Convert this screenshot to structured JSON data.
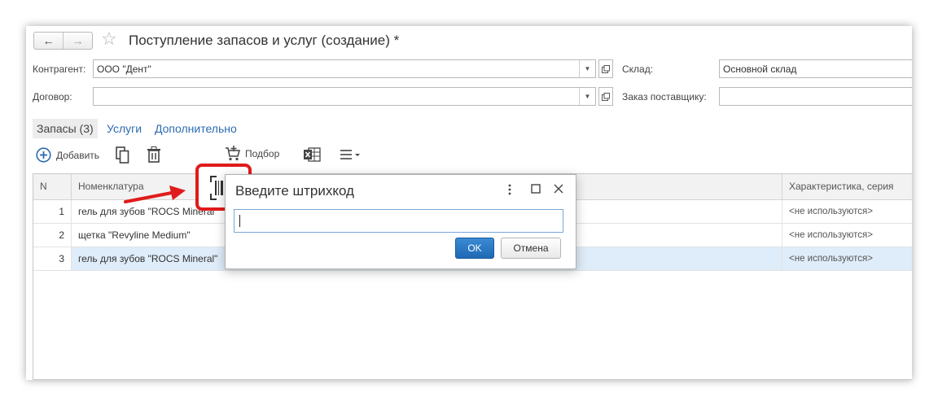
{
  "window": {
    "title": "Поступление запасов и услуг (создание) *",
    "nav": {
      "back": "←",
      "forward": "→"
    }
  },
  "form": {
    "counterparty": {
      "label": "Контрагент:",
      "value": "ООО \"Дент\""
    },
    "contract": {
      "label": "Договор:",
      "value": ""
    },
    "warehouse": {
      "label": "Склад:",
      "value": "Основной склад"
    },
    "supplier_order": {
      "label": "Заказ поставщику:",
      "value": ""
    }
  },
  "tabs": [
    {
      "label": "Запасы (3)",
      "active": true
    },
    {
      "label": "Услуги",
      "active": false
    },
    {
      "label": "Дополнительно",
      "active": false
    }
  ],
  "toolbar": {
    "add_label": "Добавить",
    "pick_label": "Подбор"
  },
  "table": {
    "columns": {
      "n": "N",
      "nomenclature": "Номенклатура",
      "characteristic": "Характеристика, серия"
    },
    "rows": [
      {
        "n": "1",
        "nomenclature": "гель для зубов \"ROCS Mineral\"",
        "characteristic": "<не используются>",
        "selected": false
      },
      {
        "n": "2",
        "nomenclature": "щетка \"Revyline Medium\"",
        "characteristic": "<не используются>",
        "selected": false
      },
      {
        "n": "3",
        "nomenclature": "гель для зубов \"ROCS Mineral\"",
        "characteristic": "<не используются>",
        "selected": true
      }
    ]
  },
  "dialog": {
    "title": "Введите штрихкод",
    "input_value": "",
    "ok_label": "OK",
    "cancel_label": "Отмена"
  },
  "colors": {
    "accent": "#2c6bb0",
    "highlight": "#e01b1b",
    "ok_button": "#1f69b5",
    "selected_row": "#dfecf9"
  }
}
